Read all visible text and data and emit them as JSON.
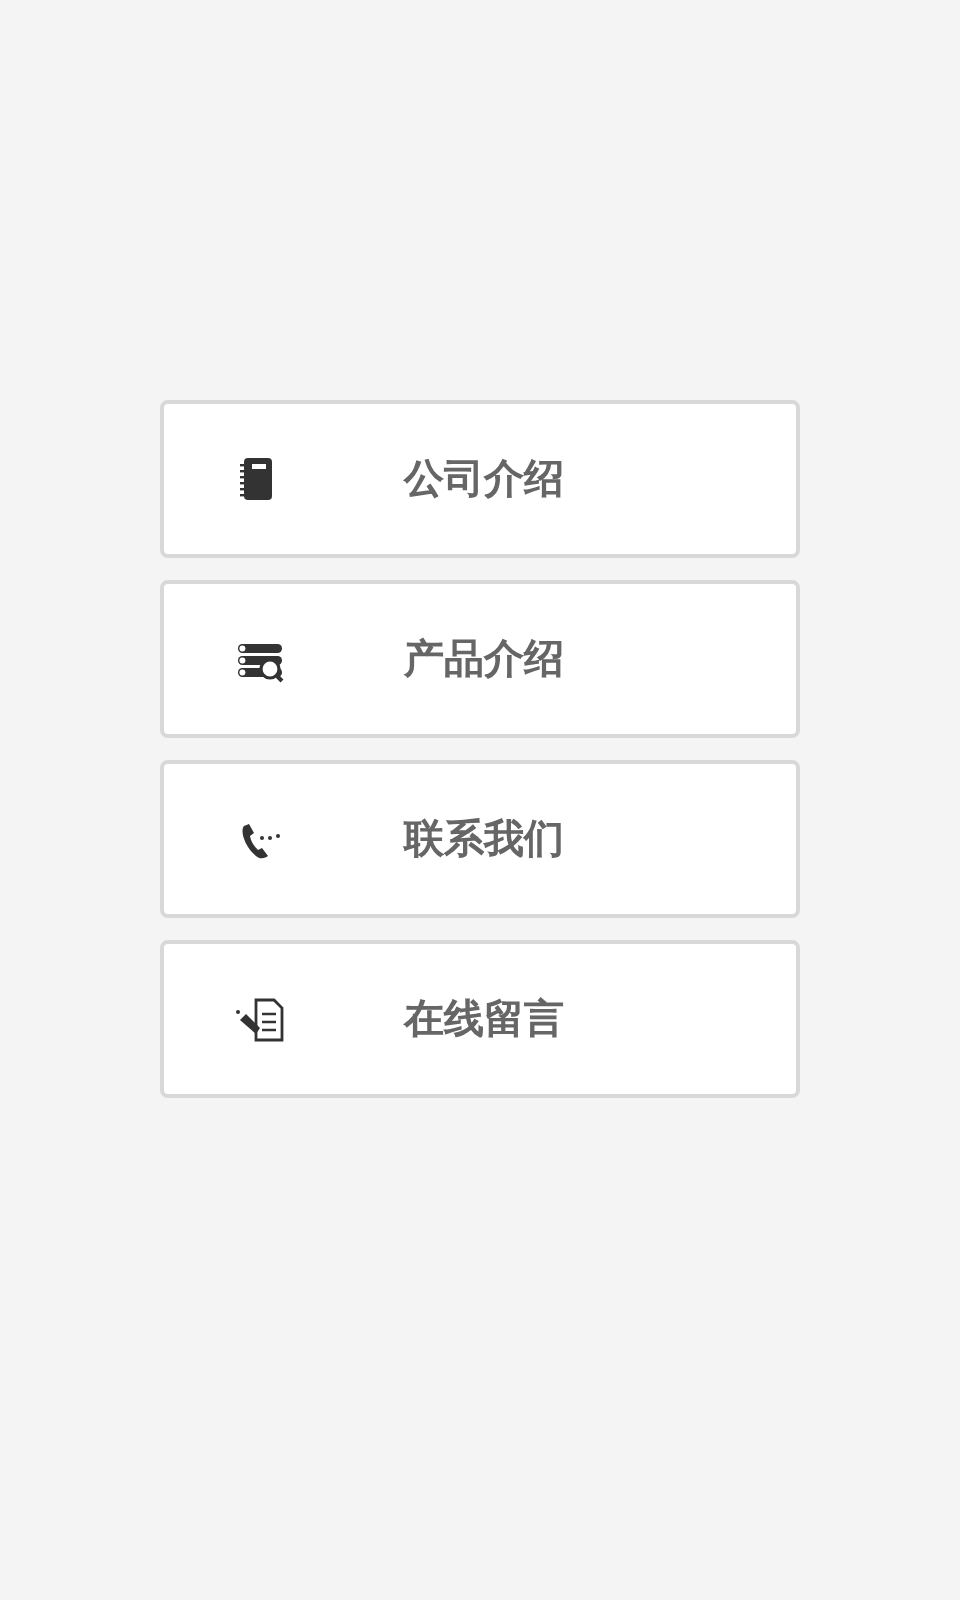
{
  "menu": [
    {
      "kind": "notebook",
      "label": "公司介绍"
    },
    {
      "kind": "list-search",
      "label": "产品介绍"
    },
    {
      "kind": "phone",
      "label": "联系我们"
    },
    {
      "kind": "document-edit",
      "label": "在线留言"
    }
  ]
}
